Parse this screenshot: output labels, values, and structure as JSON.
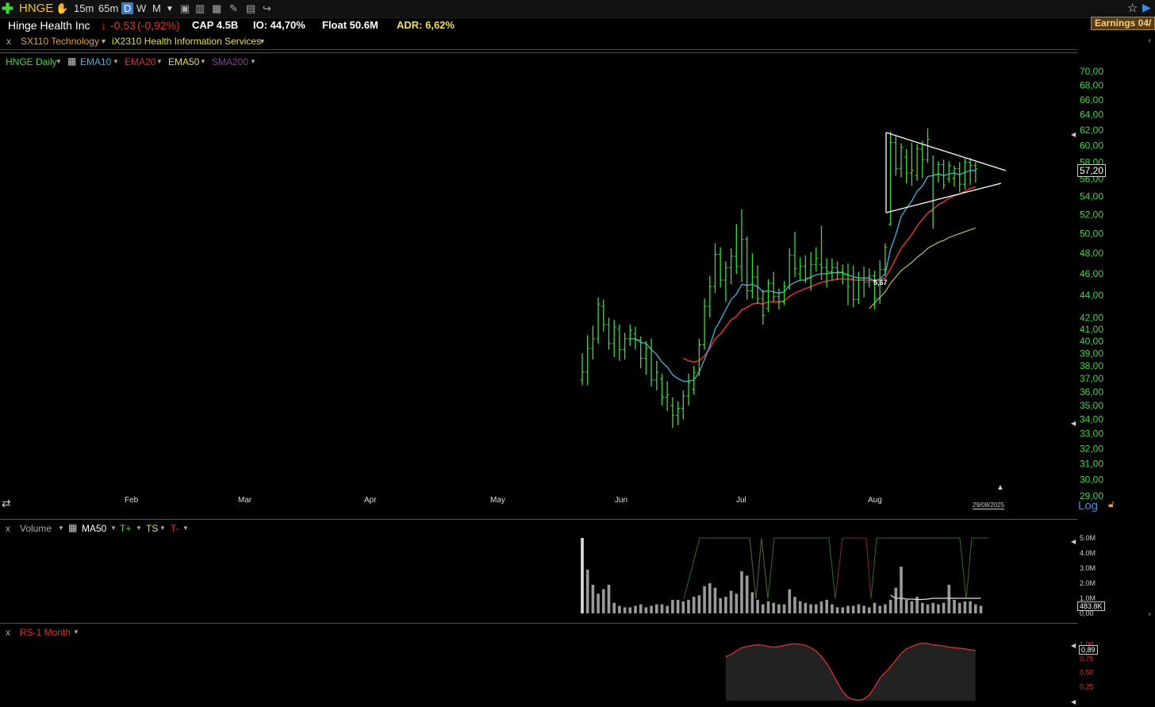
{
  "toolbar": {
    "ticker": "HNGE",
    "timeframes": [
      "15m",
      "65m",
      "D",
      "W",
      "M"
    ],
    "active_timeframe": "D"
  },
  "info": {
    "company": "Hinge Health Inc",
    "change": "-0,53",
    "change_pct": "(-0,92%)",
    "cap": "CAP 4.5B",
    "io": "IO: 44,70%",
    "float": "Float 50.6M",
    "adr": "ADR: 6,62%",
    "earnings": "Earnings 04/"
  },
  "sectors": {
    "sector": "SX110 Technology",
    "industry": "iX2310 Health Information Services"
  },
  "price_panel": {
    "legend": [
      "HNGE Daily",
      "EMA10",
      "EMA20",
      "EMA50",
      "SMA200"
    ],
    "current_price": "57,20",
    "marker_label": "5,67",
    "date_label": "29/08/2025",
    "log_label": "Log"
  },
  "volume_panel": {
    "legend": [
      "Volume",
      "MA50",
      "T+",
      "TS",
      "T-"
    ],
    "current_volume": "483.8K"
  },
  "rs_panel": {
    "legend": "RS-1 Month",
    "current": "0,89"
  },
  "colors": {
    "up": "#3fd83f",
    "ema10": "#3fb5d8",
    "ema20": "#d83030",
    "ema50": "#b8b040",
    "sma200": "#8a3aa0",
    "axis_green": "#3fd83f",
    "axis_red": "#e03030"
  },
  "chart_data": [
    {
      "type": "bar",
      "title": "HNGE Daily",
      "scale": "log",
      "months": [
        "Feb",
        "Mar",
        "Apr",
        "May",
        "Jun",
        "Jul",
        "Aug"
      ],
      "yticks": [
        "70,00",
        "68,00",
        "66,00",
        "64,00",
        "62,00",
        "60,00",
        "58,00",
        "56,00",
        "54,00",
        "52,00",
        "50,00",
        "48,00",
        "46,00",
        "44,00",
        "42,00",
        "41,00",
        "40,00",
        "39,00",
        "38,00",
        "37,00",
        "36,00",
        "35,00",
        "34,00",
        "33,00",
        "32,00",
        "31,00",
        "30,00",
        "29,00"
      ],
      "ylim": [
        28.3,
        72
      ],
      "ohlc": [
        [
          36.9,
          39.0,
          36.5,
          37.5
        ],
        [
          37.5,
          40.5,
          36.5,
          39.4
        ],
        [
          39.4,
          41.3,
          38.5,
          40.2
        ],
        [
          40.2,
          43.8,
          39.8,
          43.2
        ],
        [
          43.0,
          43.6,
          40.8,
          41.4
        ],
        [
          41.4,
          42.0,
          39.3,
          39.8
        ],
        [
          39.8,
          41.8,
          38.7,
          41.2
        ],
        [
          41.0,
          41.4,
          38.4,
          39.3
        ],
        [
          39.3,
          40.7,
          38.5,
          40.2
        ],
        [
          40.2,
          41.4,
          39.6,
          40.9
        ],
        [
          40.6,
          41.2,
          39.3,
          40.1
        ],
        [
          40.1,
          40.4,
          37.8,
          38.6
        ],
        [
          38.6,
          40.0,
          37.3,
          39.4
        ],
        [
          39.4,
          40.2,
          36.4,
          36.9
        ],
        [
          36.9,
          38.4,
          36.1,
          37.5
        ],
        [
          37.0,
          37.4,
          35.0,
          35.6
        ],
        [
          35.6,
          36.8,
          34.6,
          35.8
        ],
        [
          35.0,
          35.6,
          33.4,
          34.3
        ],
        [
          34.3,
          35.3,
          33.6,
          34.8
        ],
        [
          34.8,
          36.1,
          34.0,
          35.7
        ],
        [
          35.7,
          37.4,
          35.0,
          36.7
        ],
        [
          36.2,
          38.0,
          35.8,
          37.5
        ],
        [
          37.5,
          40.2,
          37.2,
          39.7
        ],
        [
          39.7,
          43.7,
          39.3,
          43.0
        ],
        [
          43.0,
          45.8,
          42.0,
          44.8
        ],
        [
          44.8,
          49.0,
          44.2,
          47.9
        ],
        [
          47.9,
          48.6,
          44.7,
          45.4
        ],
        [
          45.4,
          47.2,
          43.4,
          46.6
        ],
        [
          46.6,
          48.5,
          45.0,
          47.7
        ],
        [
          47.7,
          51.0,
          46.0,
          46.7
        ],
        [
          46.7,
          52.6,
          45.2,
          49.4
        ],
        [
          49.4,
          49.7,
          43.6,
          44.4
        ],
        [
          44.4,
          48.0,
          43.7,
          45.7
        ],
        [
          45.7,
          46.8,
          43.2,
          43.7
        ],
        [
          43.7,
          44.5,
          41.4,
          42.2
        ],
        [
          42.8,
          45.5,
          42.5,
          45.1
        ],
        [
          45.1,
          46.2,
          43.4,
          43.9
        ],
        [
          43.9,
          44.6,
          42.7,
          43.4
        ],
        [
          43.4,
          45.3,
          43.1,
          44.8
        ],
        [
          44.8,
          48.5,
          44.5,
          47.8
        ],
        [
          47.8,
          50.2,
          45.7,
          46.5
        ],
        [
          46.0,
          47.6,
          45.3,
          46.7
        ],
        [
          46.7,
          47.8,
          45.1,
          45.6
        ],
        [
          45.6,
          48.1,
          44.4,
          46.9
        ],
        [
          46.9,
          48.6,
          46.2,
          47.5
        ],
        [
          46.9,
          50.8,
          45.4,
          46.6
        ],
        [
          46.6,
          47.5,
          44.7,
          46.2
        ],
        [
          46.2,
          47.5,
          45.3,
          46.6
        ],
        [
          46.6,
          47.2,
          45.4,
          46.2
        ],
        [
          46.2,
          46.9,
          45.0,
          45.9
        ],
        [
          45.9,
          47.0,
          43.1,
          44.8
        ],
        [
          45.5,
          46.8,
          42.9,
          43.6
        ],
        [
          43.6,
          46.2,
          43.2,
          45.4
        ],
        [
          45.4,
          46.7,
          43.8,
          45.2
        ],
        [
          45.2,
          46.5,
          44.7,
          45.8
        ],
        [
          45.8,
          46.3,
          42.7,
          43.7
        ],
        [
          43.7,
          47.3,
          43.2,
          46.4
        ],
        [
          46.4,
          49.0,
          45.8,
          48.6
        ],
        [
          51.0,
          61.8,
          50.8,
          60.4
        ],
        [
          60.4,
          61.2,
          56.4,
          57.2
        ],
        [
          57.2,
          60.3,
          56.2,
          59.8
        ],
        [
          58.6,
          59.6,
          55.5,
          56.7
        ],
        [
          56.7,
          60.4,
          55.2,
          57.0
        ],
        [
          56.4,
          60.2,
          55.8,
          59.6
        ],
        [
          59.6,
          60.6,
          56.1,
          58.3
        ],
        [
          58.3,
          62.2,
          57.9,
          60.8
        ],
        [
          52.4,
          58.8,
          50.5,
          56.5
        ],
        [
          56.5,
          58.1,
          55.6,
          57.7
        ],
        [
          57.7,
          58.3,
          54.8,
          55.3
        ],
        [
          56.0,
          58.1,
          55.6,
          57.6
        ],
        [
          56.1,
          57.6,
          55.1,
          57.2
        ],
        [
          57.2,
          58.0,
          54.5,
          55.4
        ],
        [
          55.4,
          58.4,
          54.8,
          58.0
        ],
        [
          58.0,
          58.5,
          55.3,
          57.6
        ],
        [
          57.6,
          58.0,
          55.6,
          57.2
        ]
      ],
      "series": [
        {
          "name": "EMA10",
          "values": [
            null,
            null,
            null,
            null,
            null,
            null,
            null,
            null,
            null,
            40.2,
            40.2,
            39.9,
            39.8,
            39.3,
            38.9,
            38.3,
            37.9,
            37.3,
            37.0,
            36.8,
            36.8,
            36.9,
            37.5,
            38.5,
            39.6,
            41.0,
            41.8,
            42.7,
            43.6,
            44.1,
            45.0,
            44.9,
            45.0,
            44.8,
            44.3,
            44.4,
            44.3,
            44.2,
            44.3,
            44.9,
            45.2,
            45.4,
            45.4,
            45.7,
            45.9,
            46.0,
            46.0,
            46.1,
            46.1,
            46.1,
            45.9,
            45.7,
            45.6,
            45.6,
            45.6,
            45.3,
            45.5,
            46.0,
            48.4,
            49.9,
            51.8,
            52.7,
            53.5,
            54.6,
            55.2,
            56.3,
            56.4,
            56.6,
            56.4,
            56.6,
            56.7,
            56.5,
            56.8,
            57.0,
            57.0
          ]
        },
        {
          "name": "EMA20",
          "values": [
            null,
            null,
            null,
            null,
            null,
            null,
            null,
            null,
            null,
            null,
            null,
            null,
            null,
            null,
            null,
            null,
            null,
            null,
            null,
            38.6,
            38.4,
            38.3,
            38.4,
            38.8,
            39.4,
            40.2,
            40.6,
            41.2,
            41.8,
            42.1,
            42.7,
            42.9,
            43.2,
            43.3,
            43.2,
            43.4,
            43.4,
            43.4,
            43.5,
            43.9,
            44.2,
            44.4,
            44.6,
            44.8,
            45.0,
            45.2,
            45.3,
            45.4,
            45.5,
            45.5,
            45.5,
            45.4,
            45.4,
            45.4,
            45.4,
            45.3,
            45.4,
            45.6,
            46.5,
            47.5,
            48.5,
            49.2,
            49.9,
            50.8,
            51.5,
            52.2,
            52.6,
            53.1,
            53.4,
            53.8,
            54.1,
            54.3,
            54.6,
            54.9,
            55.1
          ]
        },
        {
          "name": "EMA50",
          "values": [
            null,
            null,
            null,
            null,
            null,
            null,
            null,
            null,
            null,
            null,
            null,
            null,
            null,
            null,
            null,
            null,
            null,
            null,
            null,
            null,
            null,
            null,
            null,
            null,
            null,
            null,
            null,
            null,
            null,
            null,
            null,
            null,
            null,
            null,
            null,
            null,
            null,
            null,
            null,
            null,
            null,
            null,
            null,
            null,
            null,
            null,
            null,
            null,
            null,
            null,
            null,
            null,
            null,
            null,
            42.8,
            43.3,
            43.8,
            44.3,
            45.1,
            45.7,
            46.3,
            46.7,
            47.1,
            47.6,
            48.0,
            48.5,
            48.8,
            49.1,
            49.3,
            49.6,
            49.8,
            50.0,
            50.2,
            50.4,
            50.6
          ]
        }
      ]
    },
    {
      "type": "bar",
      "title": "Volume",
      "yticks": [
        "5.0M",
        "4.0M",
        "3.0M",
        "2.0M",
        "1.0M",
        "0,00"
      ],
      "ylim": [
        0,
        5.0
      ],
      "values": [
        5.0,
        2.9,
        1.9,
        1.3,
        1.6,
        1.9,
        0.7,
        0.5,
        0.4,
        0.4,
        0.5,
        0.6,
        0.4,
        0.5,
        0.6,
        0.6,
        0.5,
        0.9,
        0.9,
        0.8,
        0.9,
        1.1,
        1.2,
        1.8,
        2.0,
        1.7,
        1.0,
        1.1,
        1.5,
        1.3,
        2.8,
        2.5,
        1.4,
        0.9,
        0.6,
        0.8,
        0.7,
        0.6,
        0.6,
        1.6,
        1.1,
        0.8,
        0.7,
        0.6,
        0.6,
        0.8,
        0.9,
        0.6,
        0.4,
        0.4,
        0.5,
        0.5,
        0.6,
        0.5,
        0.4,
        0.7,
        0.5,
        0.6,
        0.9,
        1.7,
        3.1,
        0.9,
        0.8,
        1.1,
        0.7,
        0.6,
        0.7,
        0.6,
        0.7,
        1.9,
        0.9,
        0.7,
        0.8,
        0.8,
        0.6,
        0.5
      ],
      "series": [
        {
          "name": "MA50",
          "values": [
            null,
            null,
            null,
            null,
            null,
            null,
            null,
            null,
            null,
            null,
            null,
            null,
            null,
            null,
            null,
            null,
            null,
            null,
            null,
            null,
            null,
            null,
            null,
            null,
            null,
            null,
            null,
            null,
            null,
            null,
            null,
            null,
            null,
            null,
            null,
            null,
            null,
            null,
            null,
            null,
            null,
            null,
            null,
            null,
            null,
            null,
            null,
            null,
            null,
            null,
            null,
            null,
            null,
            null,
            null,
            null,
            null,
            null,
            1.2,
            1.0,
            1.0,
            0.95,
            0.95,
            0.92,
            0.92,
            0.95,
            1.0,
            1.0,
            1.0,
            1.0,
            1.0,
            1.0,
            1.0,
            1.0,
            1.0,
            1.0
          ]
        }
      ]
    },
    {
      "type": "area",
      "title": "RS-1 Month",
      "yticks": [
        "1,00",
        "0,75",
        "0,50",
        "0,25"
      ],
      "ylim": [
        0,
        1.0
      ],
      "values": [
        null,
        null,
        null,
        null,
        null,
        null,
        null,
        null,
        null,
        null,
        null,
        null,
        null,
        null,
        null,
        null,
        null,
        null,
        null,
        null,
        null,
        null,
        null,
        null,
        null,
        null,
        null,
        0.78,
        0.82,
        0.88,
        0.94,
        0.96,
        0.98,
        0.99,
        0.98,
        0.96,
        0.95,
        0.96,
        0.98,
        1.0,
        1.01,
        1.0,
        0.98,
        0.94,
        0.88,
        0.78,
        0.66,
        0.5,
        0.32,
        0.16,
        0.06,
        0.02,
        0.01,
        0.03,
        0.1,
        0.24,
        0.4,
        0.5,
        0.6,
        0.72,
        0.84,
        0.92,
        0.96,
        1.0,
        1.02,
        1.01,
        0.99,
        0.98,
        0.97,
        0.95,
        0.94,
        0.93,
        0.92,
        0.9,
        0.89
      ]
    }
  ]
}
